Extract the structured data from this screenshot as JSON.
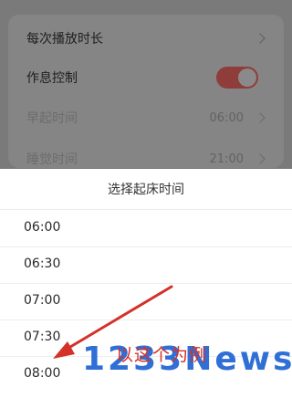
{
  "settings": {
    "rows": [
      {
        "label": "每次播放时长",
        "value": ""
      },
      {
        "label": "作息控制",
        "value": ""
      },
      {
        "label": "早起时间",
        "value": "06:00"
      },
      {
        "label": "睡觉时间",
        "value": "21:00"
      }
    ],
    "toggle_on": true
  },
  "picker": {
    "title": "选择起床时间",
    "options": [
      "06:00",
      "06:30",
      "07:00",
      "07:30",
      "08:00"
    ]
  },
  "annotation": {
    "text": "以这个为例",
    "color": "#d43128"
  },
  "watermark": "1233News",
  "colors": {
    "dim_background": "#7a7a7a",
    "toggle": "#8f3d3a",
    "watermark": "#2f6fd6"
  }
}
